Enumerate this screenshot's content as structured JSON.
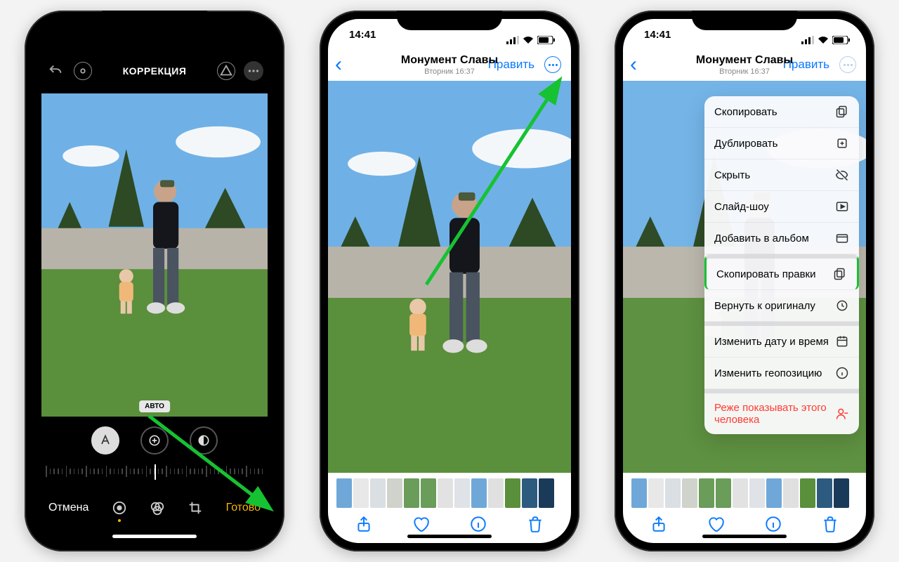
{
  "phone1": {
    "title": "КОРРЕКЦИЯ",
    "badge": "АВТО",
    "cancel": "Отмена",
    "done": "Готово"
  },
  "status": {
    "time": "14:41"
  },
  "header": {
    "title": "Монумент Славы",
    "subtitle": "Вторник  16:37",
    "edit": "Править"
  },
  "menu": {
    "items": [
      {
        "label": "Скопировать",
        "icon": "copy",
        "gap": false
      },
      {
        "label": "Дублировать",
        "icon": "duplicate",
        "gap": false
      },
      {
        "label": "Скрыть",
        "icon": "hide",
        "gap": false
      },
      {
        "label": "Слайд-шоу",
        "icon": "play",
        "gap": false
      },
      {
        "label": "Добавить в альбом",
        "icon": "album",
        "gap": false
      },
      {
        "label": "Скопировать правки",
        "icon": "copy-edits",
        "gap": true,
        "highlight": true
      },
      {
        "label": "Вернуть к оригиналу",
        "icon": "revert",
        "gap": false
      },
      {
        "label": "Изменить дату и время",
        "icon": "calendar",
        "gap": true
      },
      {
        "label": "Изменить геопозицию",
        "icon": "location",
        "gap": false
      },
      {
        "label": "Реже показывать этого человека",
        "icon": "person-minus",
        "gap": true,
        "danger": true
      }
    ]
  },
  "thumbs": [
    "#6fa8d8",
    "#e8e8e8",
    "#dadfe4",
    "#cfd3cc",
    "#6a9c5a",
    "#6a9c5a",
    "#e2e2e2",
    "#dfe2e6",
    "#6fa8d8",
    "#e0e0e0",
    "#5a8f3c",
    "#2d5a7f",
    "#1a3a5a"
  ]
}
